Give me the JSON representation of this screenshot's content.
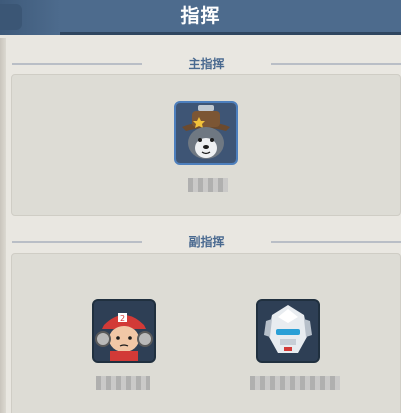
{
  "header": {
    "title": "指挥"
  },
  "sections": {
    "main": {
      "label": "主指挥"
    },
    "vice": {
      "label": "副指挥"
    }
  },
  "commanders": {
    "main": {
      "portrait": "husky-sheriff-portrait"
    },
    "vice": [
      {
        "portrait": "red-cap-boy-portrait"
      },
      {
        "portrait": "white-mech-portrait"
      }
    ]
  },
  "colors": {
    "header_bg": "#4d6b8d",
    "section_label": "#4a6a90",
    "panel_bg": "#dddcd5"
  }
}
